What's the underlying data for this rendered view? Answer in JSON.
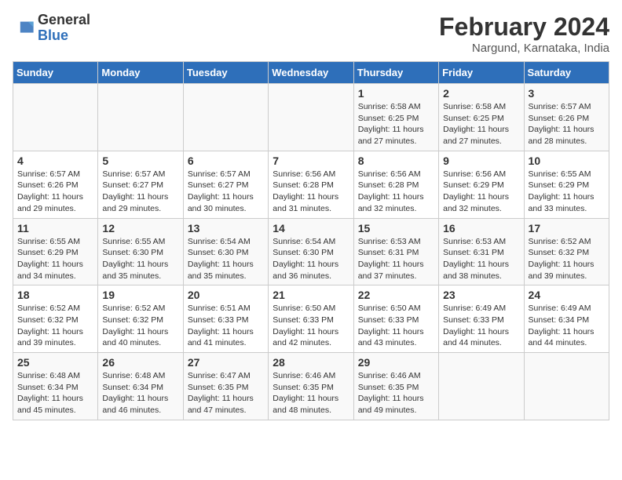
{
  "header": {
    "logo_general": "General",
    "logo_blue": "Blue",
    "month_year": "February 2024",
    "location": "Nargund, Karnataka, India"
  },
  "weekdays": [
    "Sunday",
    "Monday",
    "Tuesday",
    "Wednesday",
    "Thursday",
    "Friday",
    "Saturday"
  ],
  "weeks": [
    [
      {
        "day": "",
        "info": ""
      },
      {
        "day": "",
        "info": ""
      },
      {
        "day": "",
        "info": ""
      },
      {
        "day": "",
        "info": ""
      },
      {
        "day": "1",
        "info": "Sunrise: 6:58 AM\nSunset: 6:25 PM\nDaylight: 11 hours and 27 minutes."
      },
      {
        "day": "2",
        "info": "Sunrise: 6:58 AM\nSunset: 6:25 PM\nDaylight: 11 hours and 27 minutes."
      },
      {
        "day": "3",
        "info": "Sunrise: 6:57 AM\nSunset: 6:26 PM\nDaylight: 11 hours and 28 minutes."
      }
    ],
    [
      {
        "day": "4",
        "info": "Sunrise: 6:57 AM\nSunset: 6:26 PM\nDaylight: 11 hours and 29 minutes."
      },
      {
        "day": "5",
        "info": "Sunrise: 6:57 AM\nSunset: 6:27 PM\nDaylight: 11 hours and 29 minutes."
      },
      {
        "day": "6",
        "info": "Sunrise: 6:57 AM\nSunset: 6:27 PM\nDaylight: 11 hours and 30 minutes."
      },
      {
        "day": "7",
        "info": "Sunrise: 6:56 AM\nSunset: 6:28 PM\nDaylight: 11 hours and 31 minutes."
      },
      {
        "day": "8",
        "info": "Sunrise: 6:56 AM\nSunset: 6:28 PM\nDaylight: 11 hours and 32 minutes."
      },
      {
        "day": "9",
        "info": "Sunrise: 6:56 AM\nSunset: 6:29 PM\nDaylight: 11 hours and 32 minutes."
      },
      {
        "day": "10",
        "info": "Sunrise: 6:55 AM\nSunset: 6:29 PM\nDaylight: 11 hours and 33 minutes."
      }
    ],
    [
      {
        "day": "11",
        "info": "Sunrise: 6:55 AM\nSunset: 6:29 PM\nDaylight: 11 hours and 34 minutes."
      },
      {
        "day": "12",
        "info": "Sunrise: 6:55 AM\nSunset: 6:30 PM\nDaylight: 11 hours and 35 minutes."
      },
      {
        "day": "13",
        "info": "Sunrise: 6:54 AM\nSunset: 6:30 PM\nDaylight: 11 hours and 35 minutes."
      },
      {
        "day": "14",
        "info": "Sunrise: 6:54 AM\nSunset: 6:30 PM\nDaylight: 11 hours and 36 minutes."
      },
      {
        "day": "15",
        "info": "Sunrise: 6:53 AM\nSunset: 6:31 PM\nDaylight: 11 hours and 37 minutes."
      },
      {
        "day": "16",
        "info": "Sunrise: 6:53 AM\nSunset: 6:31 PM\nDaylight: 11 hours and 38 minutes."
      },
      {
        "day": "17",
        "info": "Sunrise: 6:52 AM\nSunset: 6:32 PM\nDaylight: 11 hours and 39 minutes."
      }
    ],
    [
      {
        "day": "18",
        "info": "Sunrise: 6:52 AM\nSunset: 6:32 PM\nDaylight: 11 hours and 39 minutes."
      },
      {
        "day": "19",
        "info": "Sunrise: 6:52 AM\nSunset: 6:32 PM\nDaylight: 11 hours and 40 minutes."
      },
      {
        "day": "20",
        "info": "Sunrise: 6:51 AM\nSunset: 6:33 PM\nDaylight: 11 hours and 41 minutes."
      },
      {
        "day": "21",
        "info": "Sunrise: 6:50 AM\nSunset: 6:33 PM\nDaylight: 11 hours and 42 minutes."
      },
      {
        "day": "22",
        "info": "Sunrise: 6:50 AM\nSunset: 6:33 PM\nDaylight: 11 hours and 43 minutes."
      },
      {
        "day": "23",
        "info": "Sunrise: 6:49 AM\nSunset: 6:33 PM\nDaylight: 11 hours and 44 minutes."
      },
      {
        "day": "24",
        "info": "Sunrise: 6:49 AM\nSunset: 6:34 PM\nDaylight: 11 hours and 44 minutes."
      }
    ],
    [
      {
        "day": "25",
        "info": "Sunrise: 6:48 AM\nSunset: 6:34 PM\nDaylight: 11 hours and 45 minutes."
      },
      {
        "day": "26",
        "info": "Sunrise: 6:48 AM\nSunset: 6:34 PM\nDaylight: 11 hours and 46 minutes."
      },
      {
        "day": "27",
        "info": "Sunrise: 6:47 AM\nSunset: 6:35 PM\nDaylight: 11 hours and 47 minutes."
      },
      {
        "day": "28",
        "info": "Sunrise: 6:46 AM\nSunset: 6:35 PM\nDaylight: 11 hours and 48 minutes."
      },
      {
        "day": "29",
        "info": "Sunrise: 6:46 AM\nSunset: 6:35 PM\nDaylight: 11 hours and 49 minutes."
      },
      {
        "day": "",
        "info": ""
      },
      {
        "day": "",
        "info": ""
      }
    ]
  ]
}
